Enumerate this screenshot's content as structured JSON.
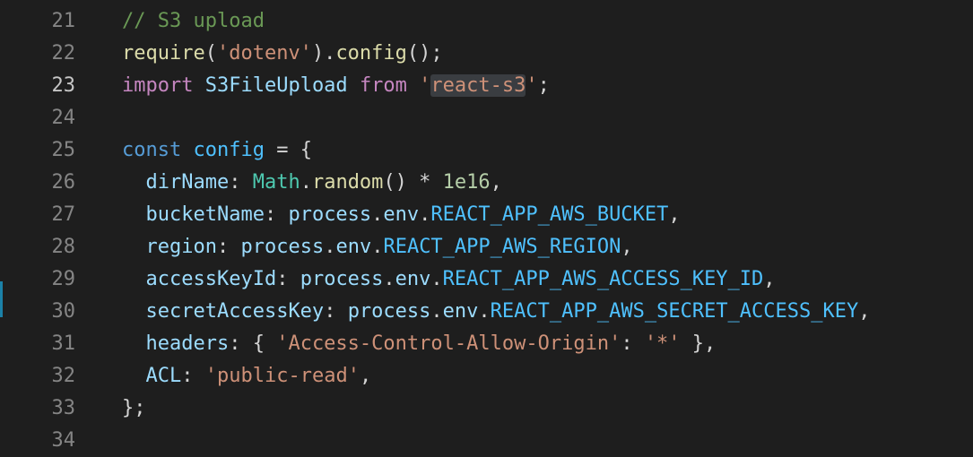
{
  "editor": {
    "lines": [
      {
        "num": "21",
        "tokens": [
          {
            "t": "// S3 upload",
            "c": "comment"
          }
        ]
      },
      {
        "num": "22",
        "tokens": [
          {
            "t": "require",
            "c": "fn"
          },
          {
            "t": "(",
            "c": "punc"
          },
          {
            "t": "'dotenv'",
            "c": "str"
          },
          {
            "t": ").",
            "c": "punc"
          },
          {
            "t": "config",
            "c": "fn"
          },
          {
            "t": "();",
            "c": "punc"
          }
        ]
      },
      {
        "num": "23",
        "active": true,
        "tokens": [
          {
            "t": "import",
            "c": "kw"
          },
          {
            "t": " ",
            "c": "punc"
          },
          {
            "t": "S3FileUpload",
            "c": "var"
          },
          {
            "t": " ",
            "c": "punc"
          },
          {
            "t": "from",
            "c": "kw"
          },
          {
            "t": " ",
            "c": "punc"
          },
          {
            "t": "'",
            "c": "str"
          },
          {
            "t": "react-s3",
            "c": "str hl"
          },
          {
            "t": "'",
            "c": "str"
          },
          {
            "t": ";",
            "c": "punc"
          }
        ]
      },
      {
        "num": "24",
        "tokens": []
      },
      {
        "num": "25",
        "tokens": [
          {
            "t": "const",
            "c": "decl"
          },
          {
            "t": " ",
            "c": "punc"
          },
          {
            "t": "config",
            "c": "const"
          },
          {
            "t": " = {",
            "c": "punc"
          }
        ]
      },
      {
        "num": "26",
        "tokens": [
          {
            "t": "  ",
            "c": "punc"
          },
          {
            "t": "dirName",
            "c": "var"
          },
          {
            "t": ": ",
            "c": "punc"
          },
          {
            "t": "Math",
            "c": "cls"
          },
          {
            "t": ".",
            "c": "punc"
          },
          {
            "t": "random",
            "c": "fn"
          },
          {
            "t": "() * ",
            "c": "punc"
          },
          {
            "t": "1e16",
            "c": "num"
          },
          {
            "t": ",",
            "c": "punc"
          }
        ]
      },
      {
        "num": "27",
        "tokens": [
          {
            "t": "  ",
            "c": "punc"
          },
          {
            "t": "bucketName",
            "c": "var"
          },
          {
            "t": ": ",
            "c": "punc"
          },
          {
            "t": "process",
            "c": "var"
          },
          {
            "t": ".",
            "c": "punc"
          },
          {
            "t": "env",
            "c": "var"
          },
          {
            "t": ".",
            "c": "punc"
          },
          {
            "t": "REACT_APP_AWS_BUCKET",
            "c": "const"
          },
          {
            "t": ",",
            "c": "punc"
          }
        ]
      },
      {
        "num": "28",
        "tokens": [
          {
            "t": "  ",
            "c": "punc"
          },
          {
            "t": "region",
            "c": "var"
          },
          {
            "t": ": ",
            "c": "punc"
          },
          {
            "t": "process",
            "c": "var"
          },
          {
            "t": ".",
            "c": "punc"
          },
          {
            "t": "env",
            "c": "var"
          },
          {
            "t": ".",
            "c": "punc"
          },
          {
            "t": "REACT_APP_AWS_REGION",
            "c": "const"
          },
          {
            "t": ",",
            "c": "punc"
          }
        ]
      },
      {
        "num": "29",
        "tokens": [
          {
            "t": "  ",
            "c": "punc"
          },
          {
            "t": "accessKeyId",
            "c": "var"
          },
          {
            "t": ": ",
            "c": "punc"
          },
          {
            "t": "process",
            "c": "var"
          },
          {
            "t": ".",
            "c": "punc"
          },
          {
            "t": "env",
            "c": "var"
          },
          {
            "t": ".",
            "c": "punc"
          },
          {
            "t": "REACT_APP_AWS_ACCESS_KEY_ID",
            "c": "const"
          },
          {
            "t": ",",
            "c": "punc"
          }
        ]
      },
      {
        "num": "30",
        "tokens": [
          {
            "t": "  ",
            "c": "punc"
          },
          {
            "t": "secretAccessKey",
            "c": "var"
          },
          {
            "t": ": ",
            "c": "punc"
          },
          {
            "t": "process",
            "c": "var"
          },
          {
            "t": ".",
            "c": "punc"
          },
          {
            "t": "env",
            "c": "var"
          },
          {
            "t": ".",
            "c": "punc"
          },
          {
            "t": "REACT_APP_AWS_SECRET_ACCESS_KEY",
            "c": "const"
          },
          {
            "t": ",",
            "c": "punc"
          }
        ]
      },
      {
        "num": "31",
        "tokens": [
          {
            "t": "  ",
            "c": "punc"
          },
          {
            "t": "headers",
            "c": "var"
          },
          {
            "t": ": { ",
            "c": "punc"
          },
          {
            "t": "'Access-Control-Allow-Origin'",
            "c": "str"
          },
          {
            "t": ": ",
            "c": "punc"
          },
          {
            "t": "'*'",
            "c": "str"
          },
          {
            "t": " },",
            "c": "punc"
          }
        ]
      },
      {
        "num": "32",
        "tokens": [
          {
            "t": "  ",
            "c": "punc"
          },
          {
            "t": "ACL",
            "c": "var"
          },
          {
            "t": ": ",
            "c": "punc"
          },
          {
            "t": "'public-read'",
            "c": "str"
          },
          {
            "t": ",",
            "c": "punc"
          }
        ]
      },
      {
        "num": "33",
        "tokens": [
          {
            "t": "};",
            "c": "punc"
          }
        ]
      },
      {
        "num": "34",
        "tokens": []
      }
    ]
  },
  "colors": {
    "background": "#1e1e1e",
    "comment": "#6a9955",
    "function": "#dcdcaa",
    "string": "#ce9178",
    "keyword": "#c586c0",
    "declaration": "#569cd6",
    "variable": "#9cdcfe",
    "constant": "#4fc1ff",
    "class": "#4ec9b0",
    "number": "#b5cea8",
    "gutter_change_marker": "#1b81a8"
  }
}
